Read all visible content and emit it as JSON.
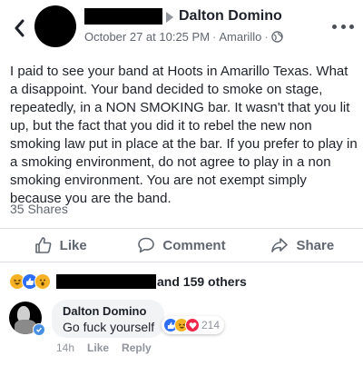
{
  "post": {
    "page_name": "Dalton Domino",
    "date": "October 27 at 10:25 PM",
    "location": "Amarillo",
    "separator": "·",
    "text": "I paid to see your band at Hoots in Amarillo Texas. What a disappoint. Your band decided to  smoke on stage, repeatedly, in a NON SMOKING bar. It wasn't that you lit up, but the fact that you did it to rebel the new non smoking law put in place at the bar. If you prefer to play in a smoking environment, do not agree to play in a non smoking environment. You are not exempt simply because you are the band.",
    "shares": "35 Shares"
  },
  "icons": {
    "back": "chevron-left-icon",
    "more": "more-dots-icon",
    "privacy": "globe-icon",
    "like": "thumbs-up-icon",
    "comment": "speech-bubble-icon",
    "share": "share-arrow-icon"
  },
  "actions": {
    "like": "Like",
    "comment": "Comment",
    "share": "Share"
  },
  "reactions": {
    "others": "and 159 others",
    "types": [
      "haha",
      "like",
      "wow"
    ]
  },
  "comment": {
    "author": "Dalton Domino",
    "text": "Go fuck yourself",
    "reaction_count": "214",
    "reaction_types": [
      "like",
      "haha",
      "love"
    ],
    "time": "14h",
    "like_label": "Like",
    "reply_label": "Reply"
  },
  "colors": {
    "like_blue": "#2e6ef7",
    "haha_yellow": "#f7b125",
    "love_red": "#f0284a",
    "meta_gray": "#616770"
  }
}
